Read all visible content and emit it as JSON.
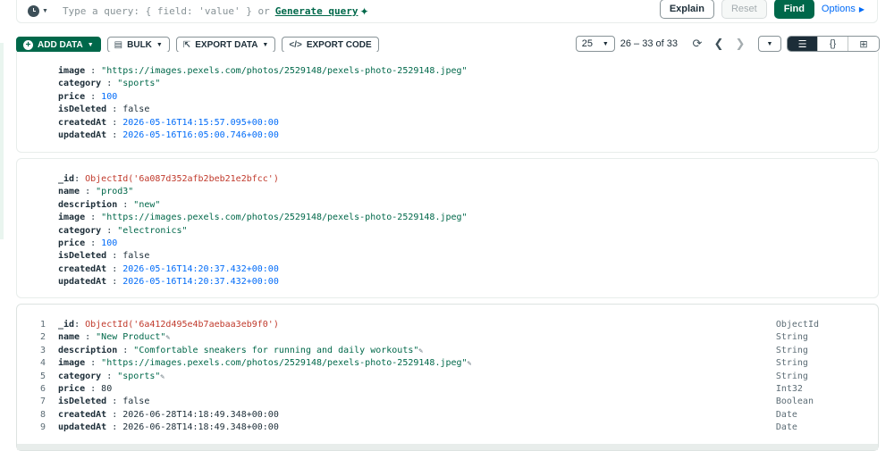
{
  "query": {
    "placeholder": "Type a query: { field: 'value' } or",
    "generate_label": "Generate query",
    "explain_label": "Explain",
    "reset_label": "Reset",
    "find_label": "Find",
    "options_label": "Options"
  },
  "toolbar": {
    "add_data_label": "ADD DATA",
    "bulk_label": "BULK",
    "export_data_label": "EXPORT DATA",
    "export_code_label": "EXPORT CODE",
    "page_size": "25",
    "range": "26 – 33 of 33"
  },
  "documents": [
    {
      "fields": [
        {
          "key": "image",
          "value": "\"https://images.pexels.com/photos/2529148/pexels-photo-2529148.jpeg\"",
          "kind": "str"
        },
        {
          "key": "category",
          "value": "\"sports\"",
          "kind": "str"
        },
        {
          "key": "price",
          "value": "100",
          "kind": "num"
        },
        {
          "key": "isDeleted",
          "value": "false",
          "kind": "bool"
        },
        {
          "key": "createdAt",
          "value": "2026-05-16T14:15:57.095+00:00",
          "kind": "num"
        },
        {
          "key": "updatedAt",
          "value": "2026-05-16T16:05:00.746+00:00",
          "kind": "num"
        }
      ]
    },
    {
      "fields": [
        {
          "key": "_id",
          "value": "ObjectId('6a087d352afb2beb21e2bfcc')",
          "kind": "oid"
        },
        {
          "key": "name",
          "value": "\"prod3\"",
          "kind": "str"
        },
        {
          "key": "description",
          "value": "\"new\"",
          "kind": "str"
        },
        {
          "key": "image",
          "value": "\"https://images.pexels.com/photos/2529148/pexels-photo-2529148.jpeg\"",
          "kind": "str"
        },
        {
          "key": "category",
          "value": "\"electronics\"",
          "kind": "str"
        },
        {
          "key": "price",
          "value": "100",
          "kind": "num"
        },
        {
          "key": "isDeleted",
          "value": "false",
          "kind": "bool"
        },
        {
          "key": "createdAt",
          "value": "2026-05-16T14:20:37.432+00:00",
          "kind": "num"
        },
        {
          "key": "updatedAt",
          "value": "2026-05-16T14:20:37.432+00:00",
          "kind": "num"
        }
      ]
    },
    {
      "fields": [
        {
          "line": "1",
          "key": "_id",
          "value": "ObjectId('6a412d495e4b7aebaa3eb9f0')",
          "kind": "oid",
          "type": "ObjectId"
        },
        {
          "line": "2",
          "key": "name",
          "value": "\"New Product\"",
          "kind": "str",
          "edit": true,
          "type": "String"
        },
        {
          "line": "3",
          "key": "description",
          "value": "\"Comfortable sneakers for running and daily workouts\"",
          "kind": "str",
          "edit": true,
          "type": "String"
        },
        {
          "line": "4",
          "key": "image",
          "value": "\"https://images.pexels.com/photos/2529148/pexels-photo-2529148.jpeg\"",
          "kind": "str",
          "edit": true,
          "type": "String"
        },
        {
          "line": "5",
          "key": "category",
          "value": "\"sports\"",
          "kind": "str",
          "edit": true,
          "type": "String"
        },
        {
          "line": "6",
          "key": "price",
          "value": "80",
          "kind": "plain",
          "type": "Int32"
        },
        {
          "line": "7",
          "key": "isDeleted",
          "value": "false",
          "kind": "plain",
          "type": "Boolean"
        },
        {
          "line": "8",
          "key": "createdAt",
          "value": "2026-06-28T14:18:49.348+00:00",
          "kind": "plain",
          "type": "Date"
        },
        {
          "line": "9",
          "key": "updatedAt",
          "value": "2026-06-28T14:18:49.348+00:00",
          "kind": "plain",
          "type": "Date"
        }
      ]
    }
  ]
}
